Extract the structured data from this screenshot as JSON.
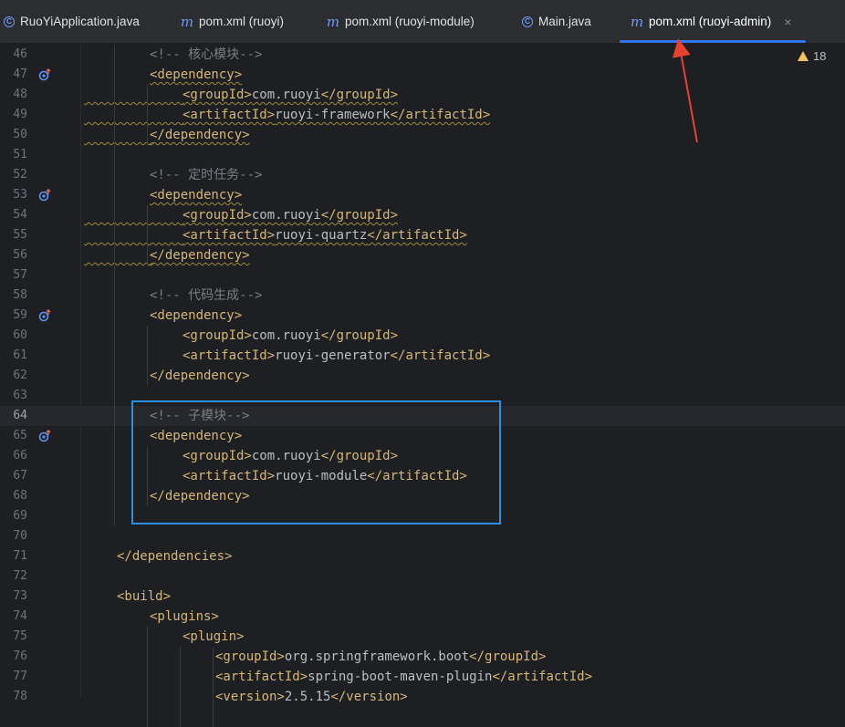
{
  "tabs": [
    {
      "label": "RuoYiApplication.java",
      "icon": "java-class-icon",
      "active": false
    },
    {
      "label": "pom.xml (ruoyi)",
      "icon": "maven-icon",
      "active": false
    },
    {
      "label": "pom.xml (ruoyi-module)",
      "icon": "maven-icon",
      "active": false
    },
    {
      "label": "Main.java",
      "icon": "java-class-icon",
      "active": false
    },
    {
      "label": "pom.xml (ruoyi-admin)",
      "icon": "maven-icon",
      "active": true
    }
  ],
  "tab_close_glyph": "×",
  "icon_glyphs": {
    "maven": "m",
    "java_class": "C"
  },
  "warnings": {
    "count": "18"
  },
  "current_line": 64,
  "colors": {
    "accent": "#3574f0",
    "tag": "#d5b778",
    "comment": "#7a7e85",
    "annotation": "#2f8ee0",
    "arrow": "#e8412f"
  },
  "lines": [
    {
      "n": "46",
      "indent": 2,
      "parts": [
        {
          "t": "<!-- 核心模块-->",
          "c": "cmt"
        }
      ]
    },
    {
      "n": "47",
      "indent": 2,
      "gutter": true,
      "parts": [
        {
          "t": "<dependency>",
          "c": "tag",
          "w": true
        }
      ]
    },
    {
      "n": "48",
      "indent": 3,
      "wavyLead": true,
      "parts": [
        {
          "t": "<groupId>",
          "c": "tag",
          "w": true
        },
        {
          "t": "com.ruoyi",
          "c": "txt",
          "w": true
        },
        {
          "t": "</groupId>",
          "c": "tag",
          "w": true
        }
      ]
    },
    {
      "n": "49",
      "indent": 3,
      "wavyLead": true,
      "parts": [
        {
          "t": "<artifactId>",
          "c": "tag",
          "w": true
        },
        {
          "t": "ruoyi-framework",
          "c": "txt",
          "w": true
        },
        {
          "t": "</artifactId>",
          "c": "tag",
          "w": true
        }
      ]
    },
    {
      "n": "50",
      "indent": 2,
      "wavyLead": true,
      "parts": [
        {
          "t": "</dependency>",
          "c": "tag",
          "w": true
        }
      ]
    },
    {
      "n": "51",
      "indent": 0,
      "parts": []
    },
    {
      "n": "52",
      "indent": 2,
      "parts": [
        {
          "t": "<!-- 定时任务-->",
          "c": "cmt"
        }
      ]
    },
    {
      "n": "53",
      "indent": 2,
      "gutter": true,
      "parts": [
        {
          "t": "<dependency>",
          "c": "tag",
          "w": true
        }
      ]
    },
    {
      "n": "54",
      "indent": 3,
      "wavyLead": true,
      "parts": [
        {
          "t": "<groupId>",
          "c": "tag",
          "w": true
        },
        {
          "t": "com.ruoyi",
          "c": "txt",
          "w": true
        },
        {
          "t": "</groupId>",
          "c": "tag",
          "w": true
        }
      ]
    },
    {
      "n": "55",
      "indent": 3,
      "wavyLead": true,
      "parts": [
        {
          "t": "<artifactId>",
          "c": "tag",
          "w": true
        },
        {
          "t": "ruoyi-quartz",
          "c": "txt",
          "w": true
        },
        {
          "t": "</artifactId>",
          "c": "tag",
          "w": true
        }
      ]
    },
    {
      "n": "56",
      "indent": 2,
      "wavyLead": true,
      "parts": [
        {
          "t": "</dependency>",
          "c": "tag",
          "w": true
        }
      ]
    },
    {
      "n": "57",
      "indent": 0,
      "parts": []
    },
    {
      "n": "58",
      "indent": 2,
      "parts": [
        {
          "t": "<!-- 代码生成-->",
          "c": "cmt"
        }
      ]
    },
    {
      "n": "59",
      "indent": 2,
      "gutter": true,
      "parts": [
        {
          "t": "<dependency>",
          "c": "tag"
        }
      ]
    },
    {
      "n": "60",
      "indent": 3,
      "parts": [
        {
          "t": "<groupId>",
          "c": "tag"
        },
        {
          "t": "com.ruoyi",
          "c": "txt"
        },
        {
          "t": "</groupId>",
          "c": "tag"
        }
      ]
    },
    {
      "n": "61",
      "indent": 3,
      "parts": [
        {
          "t": "<artifactId>",
          "c": "tag"
        },
        {
          "t": "ruoyi-generator",
          "c": "txt"
        },
        {
          "t": "</artifactId>",
          "c": "tag"
        }
      ]
    },
    {
      "n": "62",
      "indent": 2,
      "parts": [
        {
          "t": "</dependency>",
          "c": "tag"
        }
      ]
    },
    {
      "n": "63",
      "indent": 0,
      "parts": []
    },
    {
      "n": "64",
      "indent": 2,
      "parts": [
        {
          "t": "<!-- 子模块-->",
          "c": "cmt"
        }
      ]
    },
    {
      "n": "65",
      "indent": 2,
      "gutter": true,
      "parts": [
        {
          "t": "<dependency>",
          "c": "tag"
        }
      ]
    },
    {
      "n": "66",
      "indent": 3,
      "parts": [
        {
          "t": "<groupId>",
          "c": "tag"
        },
        {
          "t": "com.ruoyi",
          "c": "txt"
        },
        {
          "t": "</groupId>",
          "c": "tag"
        }
      ]
    },
    {
      "n": "67",
      "indent": 3,
      "parts": [
        {
          "t": "<artifactId>",
          "c": "tag"
        },
        {
          "t": "ruoyi-module",
          "c": "txt"
        },
        {
          "t": "</artifactId>",
          "c": "tag"
        }
      ]
    },
    {
      "n": "68",
      "indent": 2,
      "parts": [
        {
          "t": "</dependency>",
          "c": "tag"
        }
      ]
    },
    {
      "n": "69",
      "indent": 0,
      "parts": []
    },
    {
      "n": "70",
      "indent": 0,
      "parts": []
    },
    {
      "n": "71",
      "indent": 1,
      "parts": [
        {
          "t": "</dependencies>",
          "c": "tag"
        }
      ]
    },
    {
      "n": "72",
      "indent": 0,
      "parts": []
    },
    {
      "n": "73",
      "indent": 1,
      "parts": [
        {
          "t": "<build>",
          "c": "tag"
        }
      ]
    },
    {
      "n": "74",
      "indent": 2,
      "parts": [
        {
          "t": "<plugins>",
          "c": "tag"
        }
      ]
    },
    {
      "n": "75",
      "indent": 3,
      "parts": [
        {
          "t": "<plugin>",
          "c": "tag"
        }
      ]
    },
    {
      "n": "76",
      "indent": 4,
      "parts": [
        {
          "t": "<groupId>",
          "c": "tag"
        },
        {
          "t": "org.springframework.boot",
          "c": "txt"
        },
        {
          "t": "</groupId>",
          "c": "tag"
        }
      ]
    },
    {
      "n": "77",
      "indent": 4,
      "parts": [
        {
          "t": "<artifactId>",
          "c": "tag"
        },
        {
          "t": "spring-boot-maven-plugin",
          "c": "txt"
        },
        {
          "t": "</artifactId>",
          "c": "tag"
        }
      ]
    },
    {
      "n": "78",
      "indent": 4,
      "parts": [
        {
          "t": "<version>",
          "c": "tag"
        },
        {
          "t": "2.5.15",
          "c": "txt"
        },
        {
          "t": "</version>",
          "c": "tag"
        }
      ]
    }
  ]
}
